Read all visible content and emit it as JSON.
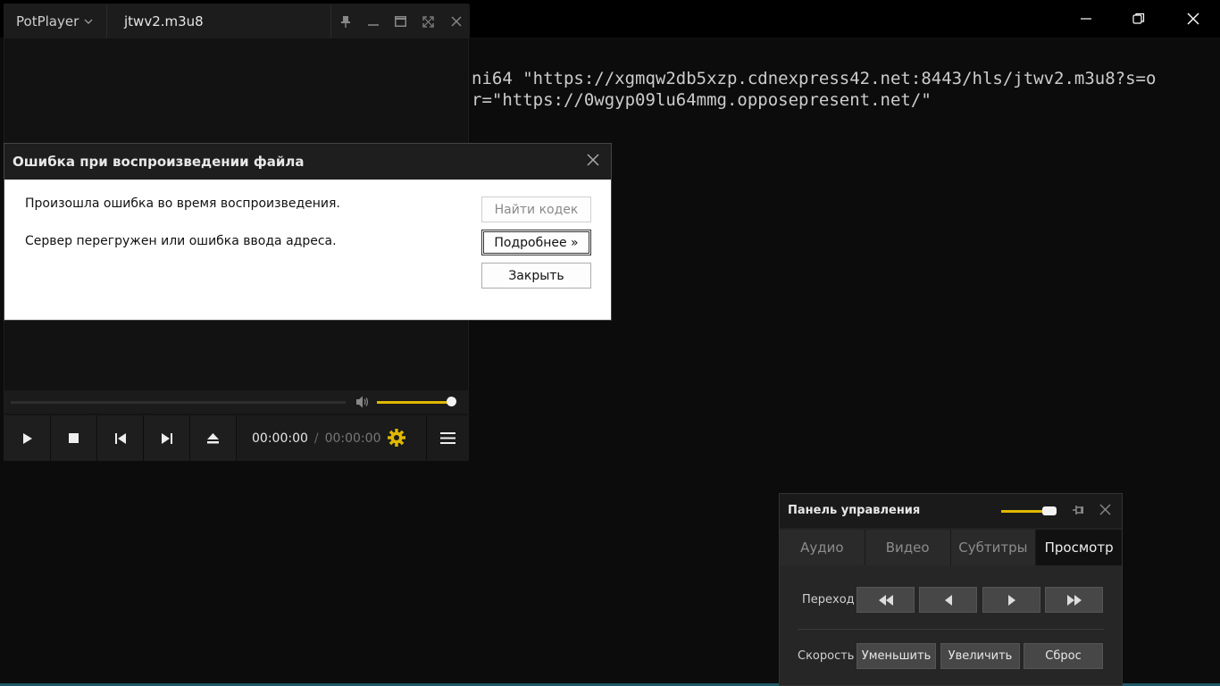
{
  "terminal": {
    "line1": "ni64 \"https://xgmqw2db5xzp.cdnexpress42.net:8443/hls/jtwv2.m3u8?s=o",
    "line2": "r=\"https://0wgyp09lu64mmg.opposepresent.net/\""
  },
  "player": {
    "brand": "PotPlayer",
    "file_name": "jtwv2.m3u8",
    "time_current": "00:00:00",
    "time_separator": "/",
    "time_total": "00:00:00",
    "volume_level": 1.0,
    "accent_color": "#e0b800"
  },
  "error_dialog": {
    "title": "Ошибка при воспроизведении файла",
    "message1": "Произошла ошибка во время воспроизведения.",
    "message2": "Сервер перегружен или ошибка ввода адреса.",
    "find_codec": "Найти кодек",
    "more": "Подробнее »",
    "close": "Закрыть"
  },
  "control_panel": {
    "title": "Панель управления",
    "tabs": [
      {
        "label": "Аудио"
      },
      {
        "label": "Видео"
      },
      {
        "label": "Субтитры"
      },
      {
        "label": "Просмотр"
      }
    ],
    "seek_label": "Переход",
    "speed_label": "Скорость",
    "speed_decrease": "Уменьшить",
    "speed_increase": "Увеличить",
    "speed_reset": "Сброс"
  }
}
